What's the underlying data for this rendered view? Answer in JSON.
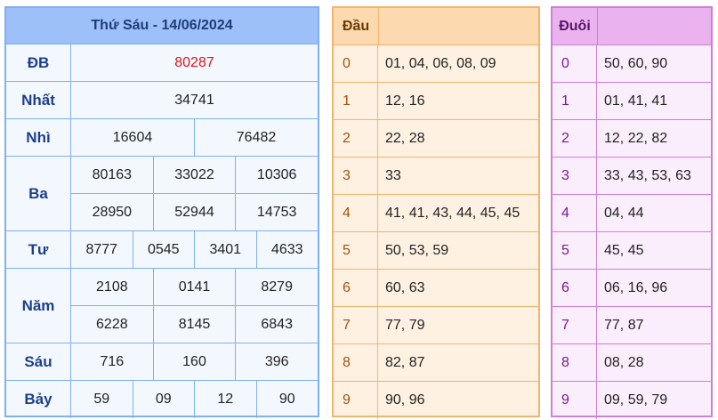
{
  "results": {
    "title": "Thứ Sáu - 14/06/2024",
    "db": {
      "label": "ĐB",
      "numbers": [
        "80287"
      ]
    },
    "nhat": {
      "label": "Nhất",
      "numbers": [
        "34741"
      ]
    },
    "nhi": {
      "label": "Nhì",
      "numbers": [
        "16604",
        "76482"
      ]
    },
    "ba": {
      "label": "Ba",
      "numbers": [
        "80163",
        "33022",
        "10306",
        "28950",
        "52944",
        "14753"
      ]
    },
    "tu": {
      "label": "Tư",
      "numbers": [
        "8777",
        "0545",
        "3401",
        "4633"
      ]
    },
    "nam": {
      "label": "Năm",
      "numbers": [
        "2108",
        "0141",
        "8279",
        "6228",
        "8145",
        "6843"
      ]
    },
    "sau": {
      "label": "Sáu",
      "numbers": [
        "716",
        "160",
        "396"
      ]
    },
    "bay": {
      "label": "Bảy",
      "numbers": [
        "59",
        "09",
        "12",
        "90"
      ]
    }
  },
  "dau": {
    "header": "Đầu",
    "rows": [
      {
        "key": "0",
        "value": "01, 04, 06, 08, 09"
      },
      {
        "key": "1",
        "value": "12, 16"
      },
      {
        "key": "2",
        "value": "22, 28"
      },
      {
        "key": "3",
        "value": "33"
      },
      {
        "key": "4",
        "value": "41, 41, 43, 44, 45, 45"
      },
      {
        "key": "5",
        "value": "50, 53, 59"
      },
      {
        "key": "6",
        "value": "60, 63"
      },
      {
        "key": "7",
        "value": "77, 79"
      },
      {
        "key": "8",
        "value": "82, 87"
      },
      {
        "key": "9",
        "value": "90, 96"
      }
    ]
  },
  "duoi": {
    "header": "Đuôi",
    "rows": [
      {
        "key": "0",
        "value": "50, 60, 90"
      },
      {
        "key": "1",
        "value": "01, 41, 41"
      },
      {
        "key": "2",
        "value": "12, 22, 82"
      },
      {
        "key": "3",
        "value": "33, 43, 53, 63"
      },
      {
        "key": "4",
        "value": "04, 44"
      },
      {
        "key": "5",
        "value": "45, 45"
      },
      {
        "key": "6",
        "value": "06, 16, 96"
      },
      {
        "key": "7",
        "value": "77, 87"
      },
      {
        "key": "8",
        "value": "08, 28"
      },
      {
        "key": "9",
        "value": "09, 59, 79"
      }
    ]
  },
  "colors": {
    "results_border": "#7fb0f0",
    "results_header": "#9cc0f7",
    "special_number": "#e0141b",
    "dau_border": "#f1b46e",
    "duoi_border": "#cc7fd6"
  }
}
